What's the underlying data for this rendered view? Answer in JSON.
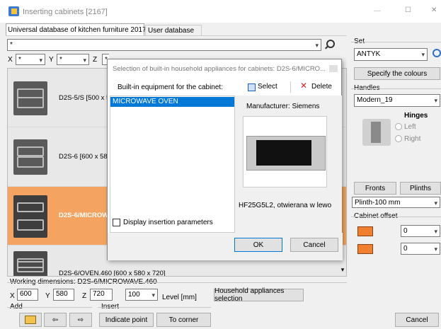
{
  "window": {
    "title": "Inserting cabinets [2167]",
    "minimize": "—",
    "maximize": "☐",
    "close": "✕"
  },
  "tabs": [
    {
      "label": "Universal database of kitchen furniture 2017"
    },
    {
      "label": "User database"
    }
  ],
  "filter": {
    "value": "*"
  },
  "dims": {
    "x_label": "X",
    "x_value": "*",
    "y_label": "Y",
    "y_value": "*",
    "z_label": "Z",
    "z_value": "*"
  },
  "rows": [
    {
      "label": "D2S-5/S  [500 x 5"
    },
    {
      "label": "D2S-6  [600 x 58"
    },
    {
      "label": "D2S-6/MICROW"
    },
    {
      "label": "D2S-6/OVEN.460  [600 x 580 x 720]"
    }
  ],
  "working": {
    "title": "Working dimensions: D2S-6/MICROWAVE.460",
    "x_label": "X",
    "x": "600",
    "y_label": "Y",
    "y": "580",
    "z_label": "Z",
    "z": "720",
    "level": "100",
    "level_label": "Level [mm]",
    "appliances_button": "Household appliances selection"
  },
  "add": {
    "label": "Add"
  },
  "insert": {
    "label": "Insert",
    "point": "Indicate point",
    "corner": "To corner"
  },
  "cancel": "Cancel",
  "right": {
    "set_label": "Set",
    "set_value": "ANTYK",
    "colours_button": "Specify the colours",
    "handles_label": "Handles",
    "handles_value": "Modern_19",
    "hinges_label": "Hinges",
    "left": "Left",
    "right": "Right",
    "fronts": "Fronts",
    "plinths": "Plinths",
    "plinth_value": "Plinth-100 mm",
    "offset_label": "Cabinet offset",
    "offset1": "0",
    "offset2": "0"
  },
  "dialog": {
    "title": "Selection of built-in household appliances for cabinets: D2S-6/MICRO...",
    "builtin_label": "Built-in equipment for the cabinet:",
    "select": "Select",
    "delete": "Delete",
    "list_item": "MICROWAVE OVEN",
    "manufacturer": "Manufacturer: Siemens",
    "model": "HF25G5L2, otwierana w lewo",
    "display_params": "Display insertion parameters",
    "ok": "OK",
    "cancel": "Cancel"
  },
  "colors": {
    "accent": "#0078d7",
    "selected_row": "#f4a460"
  }
}
